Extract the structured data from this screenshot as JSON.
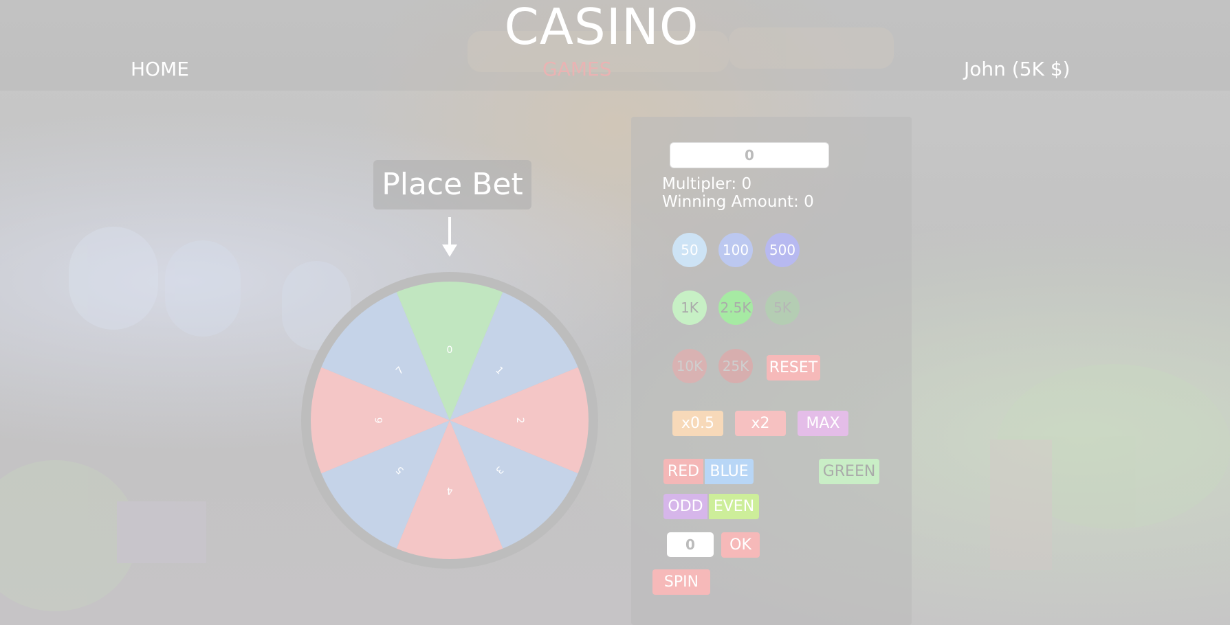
{
  "header": {
    "title": "CASINO",
    "nav": {
      "home": "HOME",
      "games": "GAMES",
      "user": "John (5K $)"
    }
  },
  "game": {
    "place_bet_label": "Place Bet",
    "wheel": {
      "segments": [
        {
          "label": "0",
          "color": "#c1e6c0"
        },
        {
          "label": "1",
          "color": "#c5d3e8"
        },
        {
          "label": "2",
          "color": "#f4c6c6"
        },
        {
          "label": "3",
          "color": "#c5d3e8"
        },
        {
          "label": "4",
          "color": "#f4c6c6"
        },
        {
          "label": "5",
          "color": "#c5d3e8"
        },
        {
          "label": "6",
          "color": "#f4c6c6"
        },
        {
          "label": "7",
          "color": "#c5d3e8"
        }
      ],
      "rim_color": "#bdbdbd"
    }
  },
  "panel": {
    "bet_value": "0",
    "multiplier_text": "Multipler: 0",
    "winning_text": "Winning Amount: 0",
    "chips": [
      {
        "label": "50",
        "color": "#cde3f5",
        "text_color": "#ffffff"
      },
      {
        "label": "100",
        "color": "#bcc8f0",
        "text_color": "#ffffff"
      },
      {
        "label": "500",
        "color": "#b7b9f0",
        "text_color": "#ffffff"
      },
      {
        "label": "1K",
        "color": "#c7f0c5",
        "text_color": "#aaaaaa"
      },
      {
        "label": "2.5K",
        "color": "#a6eaa3",
        "text_color": "#aaaaaa"
      },
      {
        "label": "5K",
        "color": "#b4cdb3",
        "text_color": "#b6b6b6"
      },
      {
        "label": "10K",
        "color": "#d9b2b2",
        "text_color": "#cfcfcf"
      },
      {
        "label": "25K",
        "color": "#d7aeae",
        "text_color": "#cfcfcf"
      }
    ],
    "reset_label": "RESET",
    "mult_buttons": [
      {
        "label": "x0.5",
        "color": "#f7d9b9"
      },
      {
        "label": "x2",
        "color": "#f6c1c1"
      },
      {
        "label": "MAX",
        "color": "#e4bde8"
      }
    ],
    "bet_types": {
      "red": "RED",
      "blue": "BLUE",
      "green": "GREEN",
      "odd": "ODD",
      "even": "EVEN"
    },
    "number_value": "0",
    "ok_label": "OK",
    "spin_label": "SPIN",
    "colors": {
      "red": "#f4b7b7",
      "blue": "#b8d6f6",
      "green": "#c9eec6",
      "odd": "#d6b6ea",
      "even": "#cdee9a",
      "reset": "#f6b9b9",
      "ok": "#f6b9b9",
      "spin": "#f6b9b9"
    }
  }
}
